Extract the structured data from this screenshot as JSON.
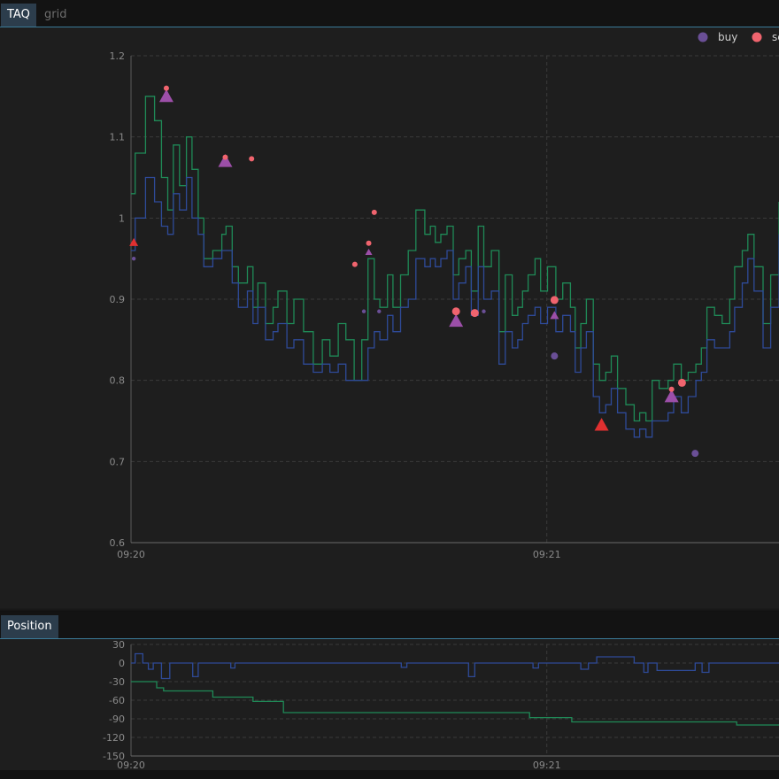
{
  "tabs": {
    "top": [
      {
        "label": "TAQ",
        "active": true
      },
      {
        "label": "grid",
        "active": false
      }
    ],
    "bottom": [
      {
        "label": "Position",
        "active": true
      }
    ]
  },
  "colors": {
    "ask_line": "#1f8a57",
    "bid_line": "#2e4a98",
    "buy": "#6a4f96",
    "sell": "#f0646e",
    "tri_purple": "#9c4fa8",
    "tri_red": "#e03030",
    "grid": "#3b3b3b",
    "axis_text": "#8a8a8a",
    "position_line": "#2e4a98",
    "pnl_line": "#1f8a57"
  },
  "chart_data": [
    {
      "type": "line",
      "title": "",
      "legend": {
        "placement": "top-right",
        "entries": [
          "buy",
          "se"
        ]
      },
      "x_ticks": [
        "09:20",
        "09:21"
      ],
      "y_ticks": [
        "0.6",
        "0.7",
        "0.8",
        "0.9",
        "1",
        "1.1",
        "1.2"
      ],
      "ylim": [
        0.6,
        1.2
      ],
      "x_unit": "seconds after 09:20",
      "xlim": [
        0,
        93.5
      ],
      "grid": true,
      "series": [
        {
          "name": "",
          "style": "step",
          "color_key": "ask_line",
          "x": [
            0.0,
            0.6,
            2.1,
            3.4,
            4.4,
            5.3,
            6.1,
            7.0,
            8.0,
            8.8,
            9.7,
            10.5,
            11.8,
            13.1,
            13.7,
            14.6,
            15.5,
            16.8,
            17.6,
            18.3,
            19.4,
            20.5,
            21.2,
            22.5,
            23.5,
            24.9,
            26.3,
            27.6,
            28.7,
            29.9,
            31.0,
            32.2,
            33.3,
            34.2,
            35.1,
            35.9,
            37.0,
            37.8,
            38.9,
            40.0,
            41.1,
            42.4,
            43.2,
            43.9,
            44.7,
            45.6,
            46.5,
            47.3,
            48.3,
            49.1,
            50.1,
            50.9,
            52.0,
            53.1,
            54.0,
            55.0,
            55.8,
            56.5,
            57.3,
            58.3,
            59.1,
            60.1,
            61.3,
            62.3,
            63.4,
            64.1,
            64.9,
            65.7,
            66.7,
            67.6,
            68.5,
            69.3,
            70.2,
            71.4,
            72.6,
            73.4,
            74.3,
            75.2,
            76.2,
            77.5,
            78.3,
            79.4,
            80.4,
            81.5,
            82.3,
            83.1,
            84.2,
            85.3,
            86.4,
            87.1,
            88.2,
            89.0,
            89.9,
            91.2,
            92.3,
            93.5
          ],
          "y": [
            1.03,
            1.08,
            1.15,
            1.12,
            1.05,
            1.01,
            1.09,
            1.04,
            1.1,
            1.06,
            1.0,
            0.95,
            0.96,
            0.98,
            0.99,
            0.94,
            0.92,
            0.94,
            0.89,
            0.92,
            0.87,
            0.89,
            0.91,
            0.87,
            0.9,
            0.86,
            0.82,
            0.85,
            0.83,
            0.87,
            0.85,
            0.8,
            0.85,
            0.95,
            0.9,
            0.89,
            0.93,
            0.89,
            0.93,
            0.96,
            1.01,
            0.98,
            0.99,
            0.97,
            0.98,
            0.99,
            0.93,
            0.95,
            0.96,
            0.91,
            0.99,
            0.94,
            0.96,
            0.86,
            0.93,
            0.88,
            0.89,
            0.91,
            0.93,
            0.95,
            0.91,
            0.94,
            0.9,
            0.92,
            0.89,
            0.84,
            0.87,
            0.9,
            0.82,
            0.8,
            0.81,
            0.83,
            0.79,
            0.77,
            0.75,
            0.76,
            0.75,
            0.8,
            0.79,
            0.8,
            0.82,
            0.8,
            0.81,
            0.82,
            0.84,
            0.89,
            0.88,
            0.87,
            0.9,
            0.94,
            0.96,
            0.98,
            0.94,
            0.87,
            0.93,
            1.02
          ]
        },
        {
          "name": "",
          "style": "step",
          "color_key": "bid_line",
          "x": [
            0.0,
            0.6,
            2.1,
            3.4,
            4.4,
            5.3,
            6.1,
            7.0,
            8.0,
            8.8,
            9.7,
            10.5,
            11.8,
            13.1,
            13.7,
            14.6,
            15.5,
            16.8,
            17.6,
            18.3,
            19.4,
            20.5,
            21.2,
            22.5,
            23.5,
            24.9,
            26.3,
            27.6,
            28.7,
            29.9,
            31.0,
            32.2,
            33.3,
            34.2,
            35.1,
            35.9,
            37.0,
            37.8,
            38.9,
            40.0,
            41.1,
            42.4,
            43.2,
            43.9,
            44.7,
            45.6,
            46.5,
            47.3,
            48.3,
            49.1,
            50.1,
            50.9,
            52.0,
            53.1,
            54.0,
            55.0,
            55.8,
            56.5,
            57.3,
            58.3,
            59.1,
            60.1,
            61.3,
            62.3,
            63.4,
            64.1,
            64.9,
            65.7,
            66.7,
            67.6,
            68.5,
            69.3,
            70.2,
            71.4,
            72.6,
            73.4,
            74.3,
            75.2,
            76.2,
            77.5,
            78.3,
            79.4,
            80.4,
            81.5,
            82.3,
            83.1,
            84.2,
            85.3,
            86.4,
            87.1,
            88.2,
            89.0,
            89.9,
            91.2,
            92.3,
            93.5
          ],
          "y": [
            0.96,
            1.0,
            1.05,
            1.02,
            0.99,
            0.98,
            1.03,
            1.01,
            1.05,
            1.0,
            0.98,
            0.94,
            0.95,
            0.96,
            0.96,
            0.92,
            0.89,
            0.91,
            0.87,
            0.89,
            0.85,
            0.86,
            0.87,
            0.84,
            0.85,
            0.82,
            0.81,
            0.82,
            0.81,
            0.82,
            0.8,
            0.8,
            0.8,
            0.84,
            0.86,
            0.85,
            0.88,
            0.86,
            0.89,
            0.9,
            0.95,
            0.94,
            0.95,
            0.94,
            0.95,
            0.96,
            0.9,
            0.92,
            0.94,
            0.88,
            0.94,
            0.9,
            0.91,
            0.82,
            0.86,
            0.84,
            0.85,
            0.87,
            0.88,
            0.89,
            0.87,
            0.89,
            0.86,
            0.88,
            0.86,
            0.81,
            0.84,
            0.86,
            0.78,
            0.76,
            0.77,
            0.79,
            0.76,
            0.74,
            0.73,
            0.74,
            0.73,
            0.75,
            0.75,
            0.76,
            0.78,
            0.76,
            0.78,
            0.8,
            0.81,
            0.85,
            0.84,
            0.84,
            0.86,
            0.89,
            0.92,
            0.95,
            0.91,
            0.84,
            0.89,
            0.98
          ]
        }
      ],
      "markers": {
        "buy": [
          {
            "x": 0.4,
            "y": 0.95
          },
          {
            "x": 33.6,
            "y": 0.885
          },
          {
            "x": 35.8,
            "y": 0.885
          },
          {
            "x": 50.9,
            "y": 0.885
          },
          {
            "x": 61.1,
            "y": 0.83
          },
          {
            "x": 81.4,
            "y": 0.71
          }
        ],
        "sell": [
          {
            "x": 5.1,
            "y": 1.16
          },
          {
            "x": 13.6,
            "y": 1.075
          },
          {
            "x": 17.4,
            "y": 1.073
          },
          {
            "x": 32.3,
            "y": 0.943
          },
          {
            "x": 34.3,
            "y": 0.969
          },
          {
            "x": 35.1,
            "y": 1.007
          },
          {
            "x": 46.9,
            "y": 0.885
          },
          {
            "x": 49.6,
            "y": 0.883
          },
          {
            "x": 61.1,
            "y": 0.899
          },
          {
            "x": 78.0,
            "y": 0.789
          },
          {
            "x": 79.5,
            "y": 0.797
          }
        ],
        "sell_large": [
          {
            "x": 46.9,
            "y": 0.885
          },
          {
            "x": 49.6,
            "y": 0.883
          },
          {
            "x": 61.1,
            "y": 0.899
          },
          {
            "x": 79.5,
            "y": 0.797
          }
        ],
        "triangles_purple": [
          {
            "x": 5.1,
            "y": 1.15,
            "size": "large"
          },
          {
            "x": 13.6,
            "y": 1.07,
            "size": "large"
          },
          {
            "x": 34.3,
            "y": 0.958,
            "size": "small"
          },
          {
            "x": 46.9,
            "y": 0.873,
            "size": "large"
          },
          {
            "x": 61.1,
            "y": 0.88,
            "size": "medium"
          },
          {
            "x": 78.0,
            "y": 0.78,
            "size": "large"
          }
        ],
        "triangles_red": [
          {
            "x": 0.4,
            "y": 0.97,
            "size": "medium"
          },
          {
            "x": 67.9,
            "y": 0.745,
            "size": "large"
          }
        ]
      }
    },
    {
      "type": "line",
      "title": "",
      "x_ticks": [
        "09:20",
        "09:21"
      ],
      "y_ticks": [
        "30",
        "0",
        "-30",
        "-60",
        "-90",
        "-120",
        "-150"
      ],
      "ylim": [
        -150,
        30
      ],
      "x_unit": "seconds after 09:20",
      "xlim": [
        0,
        93.5
      ],
      "grid": true,
      "series": [
        {
          "name": "",
          "style": "step",
          "color_key": "position_line",
          "x": [
            0,
            0.6,
            1.7,
            2.5,
            3.2,
            4.4,
            5.6,
            8.9,
            9.7,
            14.4,
            15.0,
            16.0,
            38.0,
            39.0,
            39.8,
            40.2,
            48.7,
            49.6,
            49.9,
            58.0,
            58.8,
            64.9,
            66.0,
            67.2,
            72.6,
            74.0,
            74.6,
            75.9,
            81.4,
            82.4,
            83.4,
            93.5
          ],
          "y": [
            0,
            15,
            0,
            -10,
            0,
            -25,
            0,
            -22,
            0,
            -8,
            0,
            0,
            0,
            -7,
            0,
            0,
            -22,
            0,
            0,
            -8,
            0,
            -10,
            0,
            10,
            0,
            -15,
            0,
            -12,
            0,
            -15,
            0,
            0
          ]
        },
        {
          "name": "",
          "style": "step",
          "color_key": "pnl_line",
          "x": [
            0,
            3.7,
            4.7,
            11.8,
            17.6,
            18.3,
            22.0,
            57.5,
            63.6,
            77.7,
            78.9,
            87.4,
            93.5
          ],
          "y": [
            -30,
            -40,
            -45,
            -55,
            -62,
            -62,
            -80,
            -88,
            -95,
            -95,
            -95,
            -100,
            -100
          ]
        }
      ]
    }
  ]
}
